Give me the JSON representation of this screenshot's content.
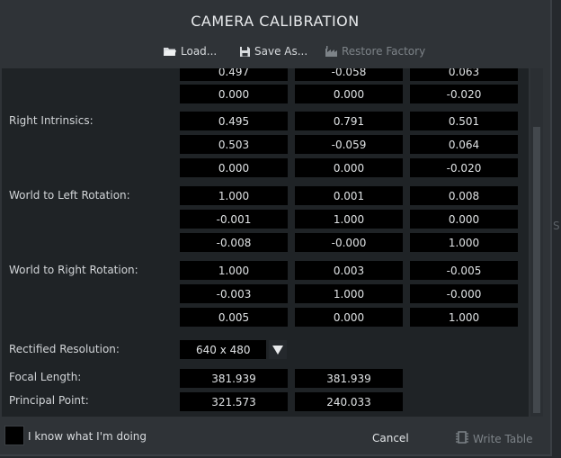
{
  "dialog": {
    "title": "CAMERA CALIBRATION",
    "toolbar": {
      "load_label": "Load...",
      "save_as_label": "Save As...",
      "restore_label": "Restore Factory"
    },
    "rows": [
      {
        "label": "",
        "values": [
          "0.497",
          "-0.058",
          "0.063"
        ]
      },
      {
        "label": "",
        "values": [
          "0.000",
          "0.000",
          "-0.020"
        ]
      },
      {
        "label": "Right Intrinsics:",
        "values": [
          "0.495",
          "0.791",
          "0.501"
        ]
      },
      {
        "label": "",
        "values": [
          "0.503",
          "-0.059",
          "0.064"
        ]
      },
      {
        "label": "",
        "values": [
          "0.000",
          "0.000",
          "-0.020"
        ]
      },
      {
        "label": "World to Left Rotation:",
        "values": [
          "1.000",
          "0.001",
          "0.008"
        ]
      },
      {
        "label": "",
        "values": [
          "-0.001",
          "1.000",
          "0.000"
        ]
      },
      {
        "label": "",
        "values": [
          "-0.008",
          "-0.000",
          "1.000"
        ]
      },
      {
        "label": "World to Right Rotation:",
        "values": [
          "1.000",
          "0.003",
          "-0.005"
        ]
      },
      {
        "label": "",
        "values": [
          "-0.003",
          "1.000",
          "-0.000"
        ]
      },
      {
        "label": "",
        "values": [
          "0.005",
          "0.000",
          "1.000"
        ]
      }
    ],
    "rectified": {
      "label": "Rectified Resolution:",
      "value": "640 x 480"
    },
    "focal": {
      "label": "Focal Length:",
      "values": [
        "381.939",
        "381.939"
      ]
    },
    "principal": {
      "label": "Principal Point:",
      "values": [
        "321.573",
        "240.033"
      ]
    },
    "footer": {
      "checkbox_label": "I know what I'm doing",
      "cancel_label": "Cancel",
      "write_label": "Write Table"
    },
    "edge_text": "S"
  }
}
